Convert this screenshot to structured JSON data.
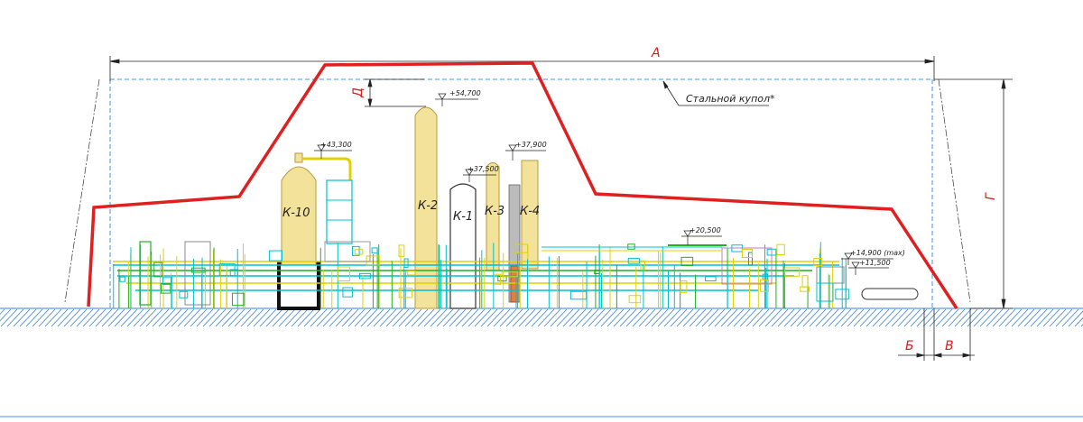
{
  "dimensions": {
    "a": "А",
    "b": "Б",
    "v": "В",
    "g": "Г",
    "d": "Д"
  },
  "dome_label": "Стальной купол*",
  "columns": {
    "k10": "К-10",
    "k2": "К-2",
    "k1": "К-1",
    "k3": "К-3",
    "k4": "К-4"
  },
  "elevations": {
    "e54700": "+54,700",
    "e43300": "+43,300",
    "e37900": "+37,900",
    "e37500": "+37,500",
    "e20500": "+20,500",
    "e14900": "+14,900 (max)",
    "e11500": "+11,500"
  },
  "colors": {
    "dome_outline": "#e02020",
    "dashed": "#4a90e2",
    "vessel_fill": "#f3e39a",
    "vessel_stroke": "#b89a3a",
    "piping_cyan": "#00c0d0",
    "piping_yellow": "#e0d000",
    "piping_green": "#20b020",
    "ground_hatch": "#3a7fd0"
  }
}
